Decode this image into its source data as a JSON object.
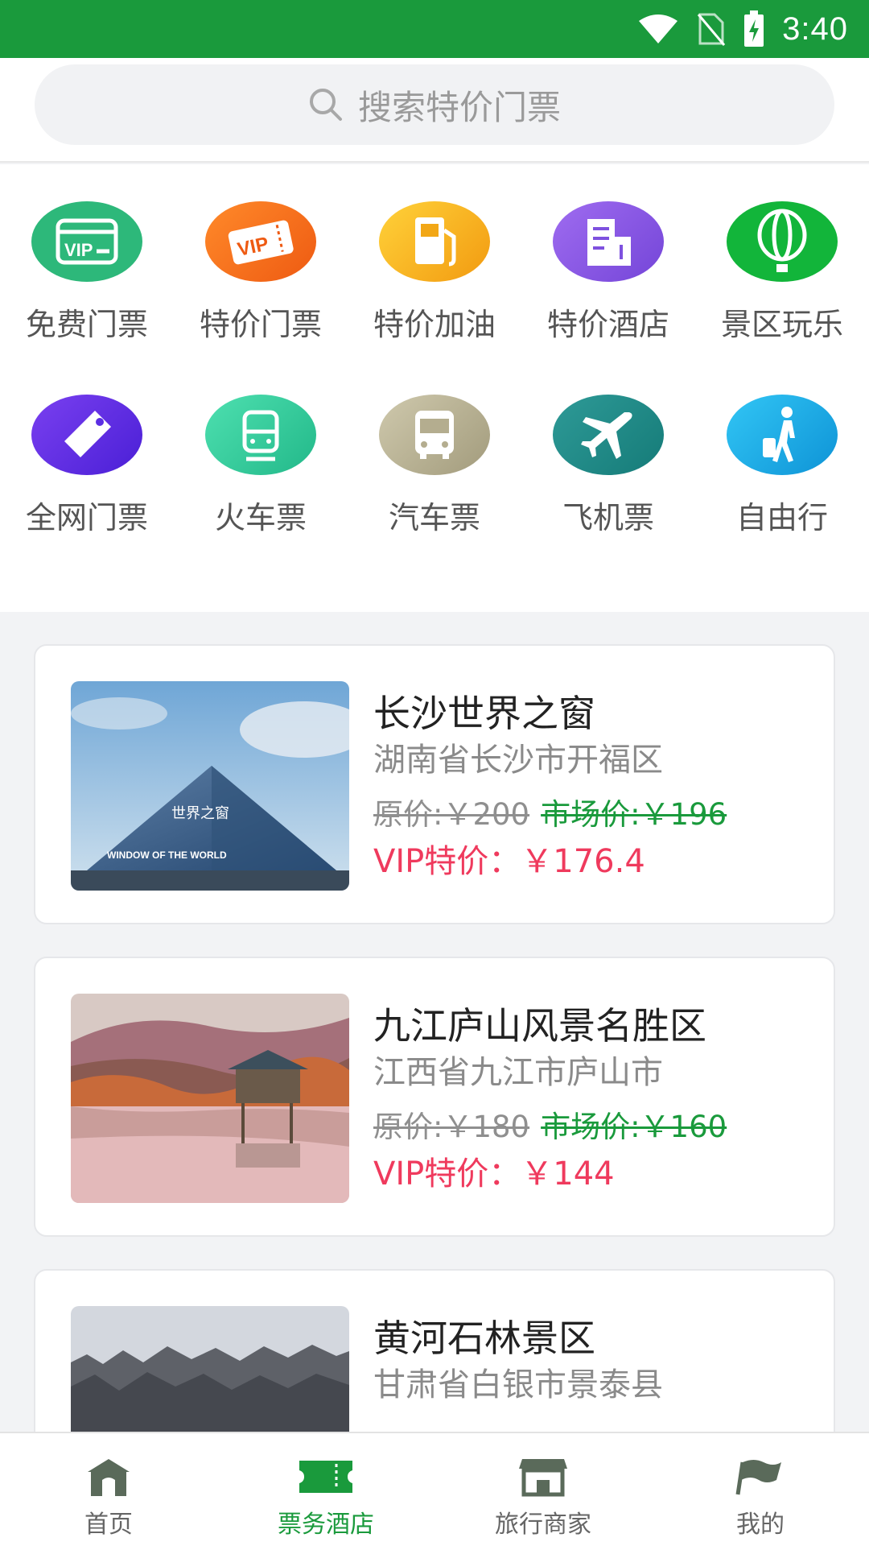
{
  "status_bar": {
    "time": "3:40"
  },
  "search": {
    "placeholder": "搜索特价门票"
  },
  "categories": [
    {
      "label": "免费门票",
      "icon": "vip-card-icon",
      "color": "#2db87a"
    },
    {
      "label": "特价门票",
      "icon": "vip-ticket-icon",
      "color": "#f56b1f"
    },
    {
      "label": "特价加油",
      "icon": "fuel-pump-icon",
      "color": "#f5b21e"
    },
    {
      "label": "特价酒店",
      "icon": "hotel-building-icon",
      "color": "#8a5ce6"
    },
    {
      "label": "景区玩乐",
      "icon": "hot-air-balloon-icon",
      "color": "#12b53a"
    },
    {
      "label": "全网门票",
      "icon": "price-tag-icon",
      "color": "#5a2ee6"
    },
    {
      "label": "火车票",
      "icon": "train-icon",
      "color": "#2ec99a"
    },
    {
      "label": "汽车票",
      "icon": "bus-icon",
      "color": "#b5ae8e"
    },
    {
      "label": "飞机票",
      "icon": "airplane-icon",
      "color": "#1f8a87"
    },
    {
      "label": "自由行",
      "icon": "traveler-icon",
      "color": "#1aa7e8"
    }
  ],
  "attractions": [
    {
      "name": "长沙世界之窗",
      "address": "湖南省长沙市开福区",
      "original_price": "原价:￥200",
      "market_price": "市场价:￥196",
      "vip_price": "VIP特价：￥176.4",
      "image_text_top": "世界之窗",
      "image_text_bottom": "WINDOW OF THE WORLD"
    },
    {
      "name": "九江庐山风景名胜区",
      "address": "江西省九江市庐山市",
      "original_price": "原价:￥180",
      "market_price": "市场价:￥160",
      "vip_price": "VIP特价：￥144"
    },
    {
      "name": "黄河石林景区",
      "address": "甘肃省白银市景泰县"
    }
  ],
  "bottom_nav": [
    {
      "label": "首页",
      "icon": "home-gate-icon",
      "active": false
    },
    {
      "label": "票务酒店",
      "icon": "ticket-icon",
      "active": true
    },
    {
      "label": "旅行商家",
      "icon": "shop-icon",
      "active": false
    },
    {
      "label": "我的",
      "icon": "flag-icon",
      "active": false
    }
  ],
  "colors": {
    "brand_green": "#1a9a3c",
    "vip_red": "#ef3a5d"
  }
}
